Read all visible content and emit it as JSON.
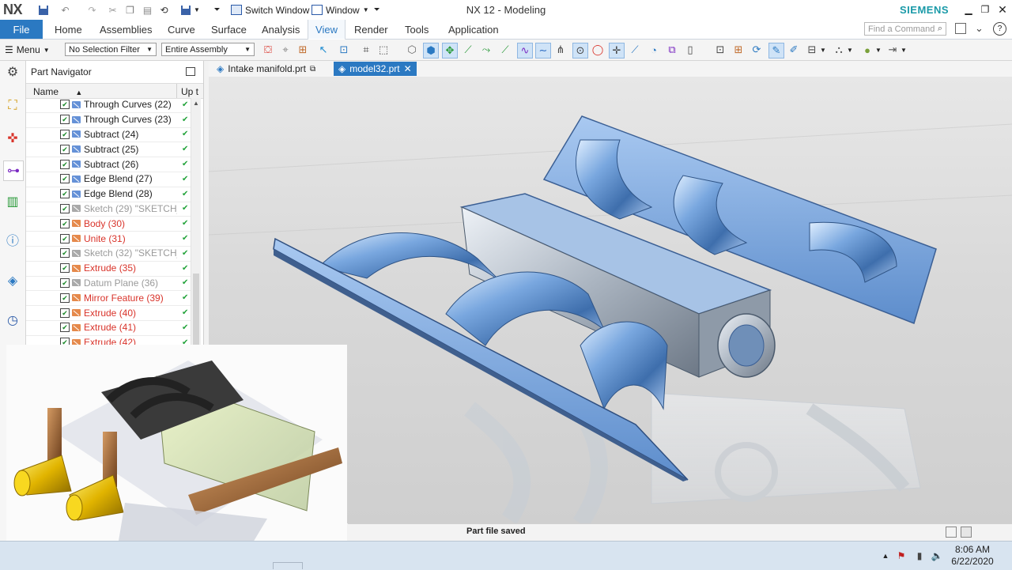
{
  "app": {
    "logo": "NX",
    "title": "NX 12 - Modeling",
    "brand": "SIEMENS",
    "switch_window": "Switch Window",
    "window_menu": "Window"
  },
  "ribbon": {
    "file": "File",
    "tabs": [
      "Home",
      "Assemblies",
      "Curve",
      "Surface",
      "Analysis",
      "View",
      "Render",
      "Tools",
      "Application"
    ],
    "active": "View",
    "find_placeholder": "Find a Command"
  },
  "toolbar": {
    "menu": "Menu",
    "selection_filter": "No Selection Filter",
    "assembly_scope": "Entire Assembly"
  },
  "navigator": {
    "title": "Part Navigator",
    "col_name": "Name",
    "col_up": "Up t",
    "items": [
      {
        "label": "Through Curves (22)",
        "style": "normal",
        "icon": "through-curves-icon"
      },
      {
        "label": "Through Curves (23)",
        "style": "normal",
        "icon": "through-curves-icon"
      },
      {
        "label": "Subtract (24)",
        "style": "normal",
        "icon": "subtract-icon"
      },
      {
        "label": "Subtract (25)",
        "style": "normal",
        "icon": "subtract-icon"
      },
      {
        "label": "Subtract (26)",
        "style": "normal",
        "icon": "subtract-icon"
      },
      {
        "label": "Edge Blend (27)",
        "style": "normal",
        "icon": "edge-blend-icon"
      },
      {
        "label": "Edge Blend (28)",
        "style": "normal",
        "icon": "edge-blend-icon"
      },
      {
        "label": "Sketch (29) \"SKETCH_...",
        "style": "gray",
        "icon": "sketch-icon"
      },
      {
        "label": "Body (30)",
        "style": "red",
        "icon": "body-icon"
      },
      {
        "label": "Unite (31)",
        "style": "red",
        "icon": "unite-icon"
      },
      {
        "label": "Sketch (32) \"SKETCH_...",
        "style": "gray",
        "icon": "sketch-icon"
      },
      {
        "label": "Extrude (35)",
        "style": "red",
        "icon": "extrude-icon"
      },
      {
        "label": "Datum Plane (36)",
        "style": "gray",
        "icon": "datum-plane-icon"
      },
      {
        "label": "Mirror Feature (39)",
        "style": "red",
        "icon": "mirror-feature-icon"
      },
      {
        "label": "Extrude (40)",
        "style": "red",
        "icon": "extrude-icon"
      },
      {
        "label": "Extrude (41)",
        "style": "red",
        "icon": "extrude-icon"
      },
      {
        "label": "Extrude (42)",
        "style": "red",
        "icon": "extrude-icon"
      }
    ]
  },
  "documents": {
    "tabs": [
      {
        "label": "Intake manifold.prt",
        "active": false
      },
      {
        "label": "model32.prt",
        "active": true
      }
    ]
  },
  "status": {
    "message": "Part file saved"
  },
  "taskbar": {
    "time": "8:06 AM",
    "date": "6/22/2020"
  },
  "colors": {
    "accent": "#2b79c2",
    "brand": "#1a9aa8",
    "feature_red": "#d9342b",
    "feature_gray": "#9a9a9a",
    "model_blue": "#6f9fd8"
  }
}
